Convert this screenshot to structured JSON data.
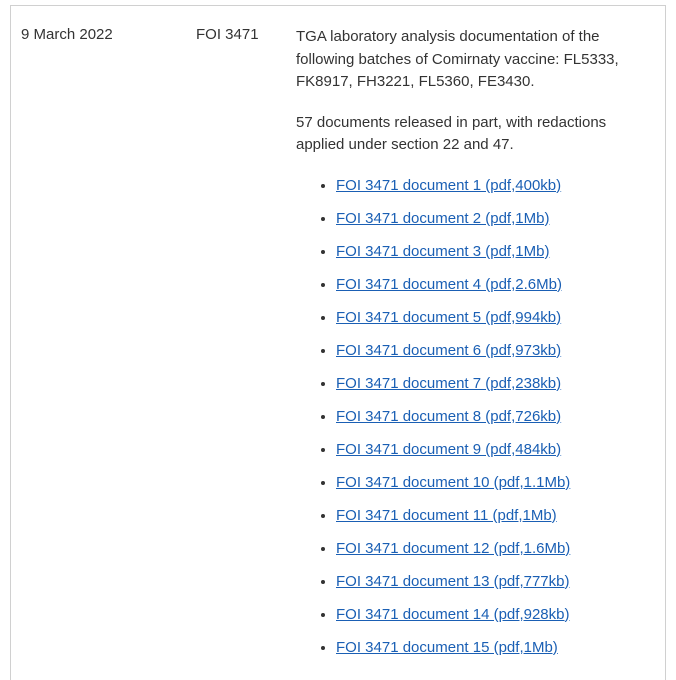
{
  "row": {
    "date": "9 March 2022",
    "ref": "FOI 3471",
    "desc_1": "TGA laboratory analysis documentation of the following batches of Comirnaty vaccine: FL5333, FK8917, FH3221, FL5360, FE3430.",
    "desc_2": "57 documents released in part, with redactions applied under section 22 and 47.",
    "documents": [
      {
        "label": "FOI 3471 document 1 (pdf,400kb)"
      },
      {
        "label": "FOI 3471 document 2 (pdf,1Mb)"
      },
      {
        "label": "FOI 3471 document 3 (pdf,1Mb)"
      },
      {
        "label": "FOI 3471 document 4 (pdf,2.6Mb)"
      },
      {
        "label": "FOI 3471 document 5 (pdf,994kb)"
      },
      {
        "label": "FOI 3471 document 6 (pdf,973kb)"
      },
      {
        "label": "FOI 3471 document 7 (pdf,238kb)"
      },
      {
        "label": "FOI 3471 document 8 (pdf,726kb)"
      },
      {
        "label": "FOI 3471 document 9 (pdf,484kb)"
      },
      {
        "label": "FOI 3471 document 10 (pdf,1.1Mb)"
      },
      {
        "label": "FOI 3471 document 11 (pdf,1Mb)"
      },
      {
        "label": "FOI 3471 document 12 (pdf,1.6Mb)"
      },
      {
        "label": "FOI 3471 document 13 (pdf,777kb)"
      },
      {
        "label": "FOI 3471 document 14 (pdf,928kb)"
      },
      {
        "label": "FOI 3471 document 15 (pdf,1Mb)"
      }
    ]
  }
}
